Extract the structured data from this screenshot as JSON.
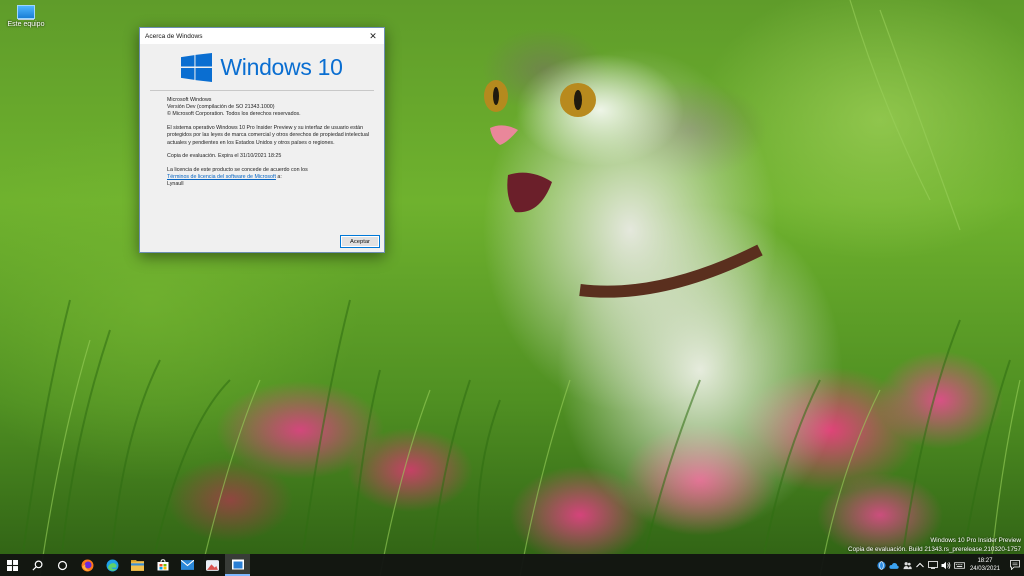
{
  "desktop": {
    "icons": [
      {
        "label": "Este equipo",
        "icon": "this-pc-icon"
      }
    ]
  },
  "dialog": {
    "title": "Acerca de Windows",
    "logo_text": "Windows 10",
    "lines": {
      "product": "Microsoft Windows",
      "version": "Versión Dev (compilación de SO 21343.1000)",
      "copyright": "© Microsoft Corporation. Todos los derechos reservados.",
      "legal": "El sistema operativo Windows 10 Pro Insider Preview y su interfaz de usuario están protegidos por las leyes de marca comercial y otros derechos de propiedad intelectual actuales y pendientes en los Estados Unidos y otros países o regiones.",
      "evaluation": "Copia de evaluación. Expira el 31/10/2021 18:25",
      "license_prefix": "La licencia de este producto se concede de acuerdo con los",
      "license_link": "Términos de licencia del software de Microsoft",
      "license_suffix": " a:",
      "user": "Lynaull"
    },
    "ok_label": "Aceptar",
    "accent": "#0a6ed1"
  },
  "watermark": {
    "line1": "Windows 10 Pro Insider Preview",
    "line2": "Copia de evaluación. Build 21343.rs_prerelease.210320-1757"
  },
  "taskbar": {
    "items": [
      {
        "icon": "start-icon"
      },
      {
        "icon": "search-icon"
      },
      {
        "icon": "task-view-icon"
      },
      {
        "icon": "firefox-icon"
      },
      {
        "icon": "edge-icon"
      },
      {
        "icon": "file-explorer-icon"
      },
      {
        "icon": "store-icon"
      },
      {
        "icon": "mail-icon"
      },
      {
        "icon": "photos-icon"
      },
      {
        "icon": "about-windows-icon",
        "active": true
      }
    ],
    "tray_icons": [
      "network-globe-icon",
      "cloud-icon",
      "people-icon",
      "chevron-up-icon",
      "wifi-icon",
      "volume-icon",
      "keyboard-icon"
    ],
    "clock_time": "18:27",
    "clock_date": "24/03/2021",
    "notification_icon": "action-center-icon"
  }
}
